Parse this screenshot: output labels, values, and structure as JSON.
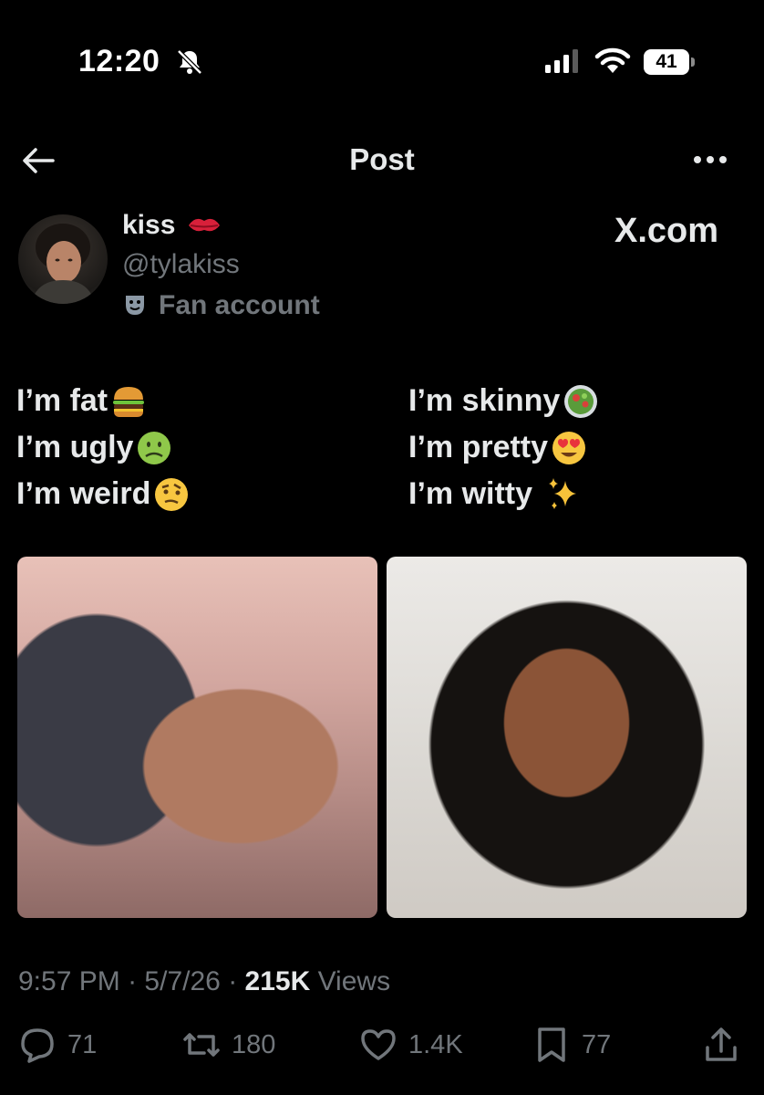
{
  "status_bar": {
    "time": "12:20",
    "battery": "41"
  },
  "header": {
    "title": "Post"
  },
  "author": {
    "display_name": "kiss",
    "handle": "@tylakiss",
    "badge_label": "Fan account",
    "watermark": "X.com"
  },
  "post": {
    "left_lines": [
      "I’m fat",
      "I’m ugly",
      "I’m weird"
    ],
    "right_lines": [
      "I’m skinny",
      "I’m pretty",
      "I’m witty"
    ],
    "left_emojis": [
      "burger-emoji",
      "nauseated-face-emoji",
      "face-with-raised-eyebrow-emoji"
    ],
    "right_emojis": [
      "salad-emoji",
      "heart-eyes-emoji",
      "sparkles-emoji"
    ]
  },
  "meta": {
    "time": "9:57 PM",
    "date": "5/7/26",
    "views_count": "215K",
    "views_label": "Views"
  },
  "actions": {
    "replies": "71",
    "reposts": "180",
    "likes": "1.4K",
    "bookmarks": "77"
  },
  "colors": {
    "background": "#000000",
    "text": "#e7e9ea",
    "muted": "#71767b"
  }
}
